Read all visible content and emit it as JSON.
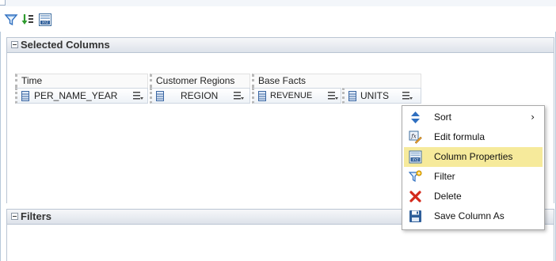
{
  "toolbar": {
    "icons": [
      "filter-icon",
      "sort-icon",
      "column-properties-icon"
    ]
  },
  "selected_columns": {
    "title": "Selected Columns",
    "groups": [
      {
        "label": "Time",
        "columns": [
          {
            "label": "PER_NAME_YEAR"
          }
        ]
      },
      {
        "label": "Customer Regions",
        "columns": [
          {
            "label": "REGION"
          }
        ]
      },
      {
        "label": "Base Facts",
        "columns": [
          {
            "label": "REVENUE"
          },
          {
            "label": "UNITS"
          }
        ]
      }
    ]
  },
  "filters": {
    "title": "Filters"
  },
  "context_menu": {
    "items": [
      {
        "label": "Sort",
        "icon": "sort-icon",
        "submenu_arrow": "›"
      },
      {
        "label": "Edit formula",
        "icon": "edit-formula-icon"
      },
      {
        "label": "Column Properties",
        "icon": "column-properties-icon",
        "highlighted": true
      },
      {
        "label": "Filter",
        "icon": "filter-add-icon"
      },
      {
        "label": "Delete",
        "icon": "delete-icon"
      },
      {
        "label": "Save Column As",
        "icon": "save-icon"
      }
    ]
  },
  "colors": {
    "highlight": "#f6ea9b",
    "header_border": "#b9c4d2",
    "delete_red": "#d42a1c",
    "icon_blue": "#2f6fc0"
  }
}
